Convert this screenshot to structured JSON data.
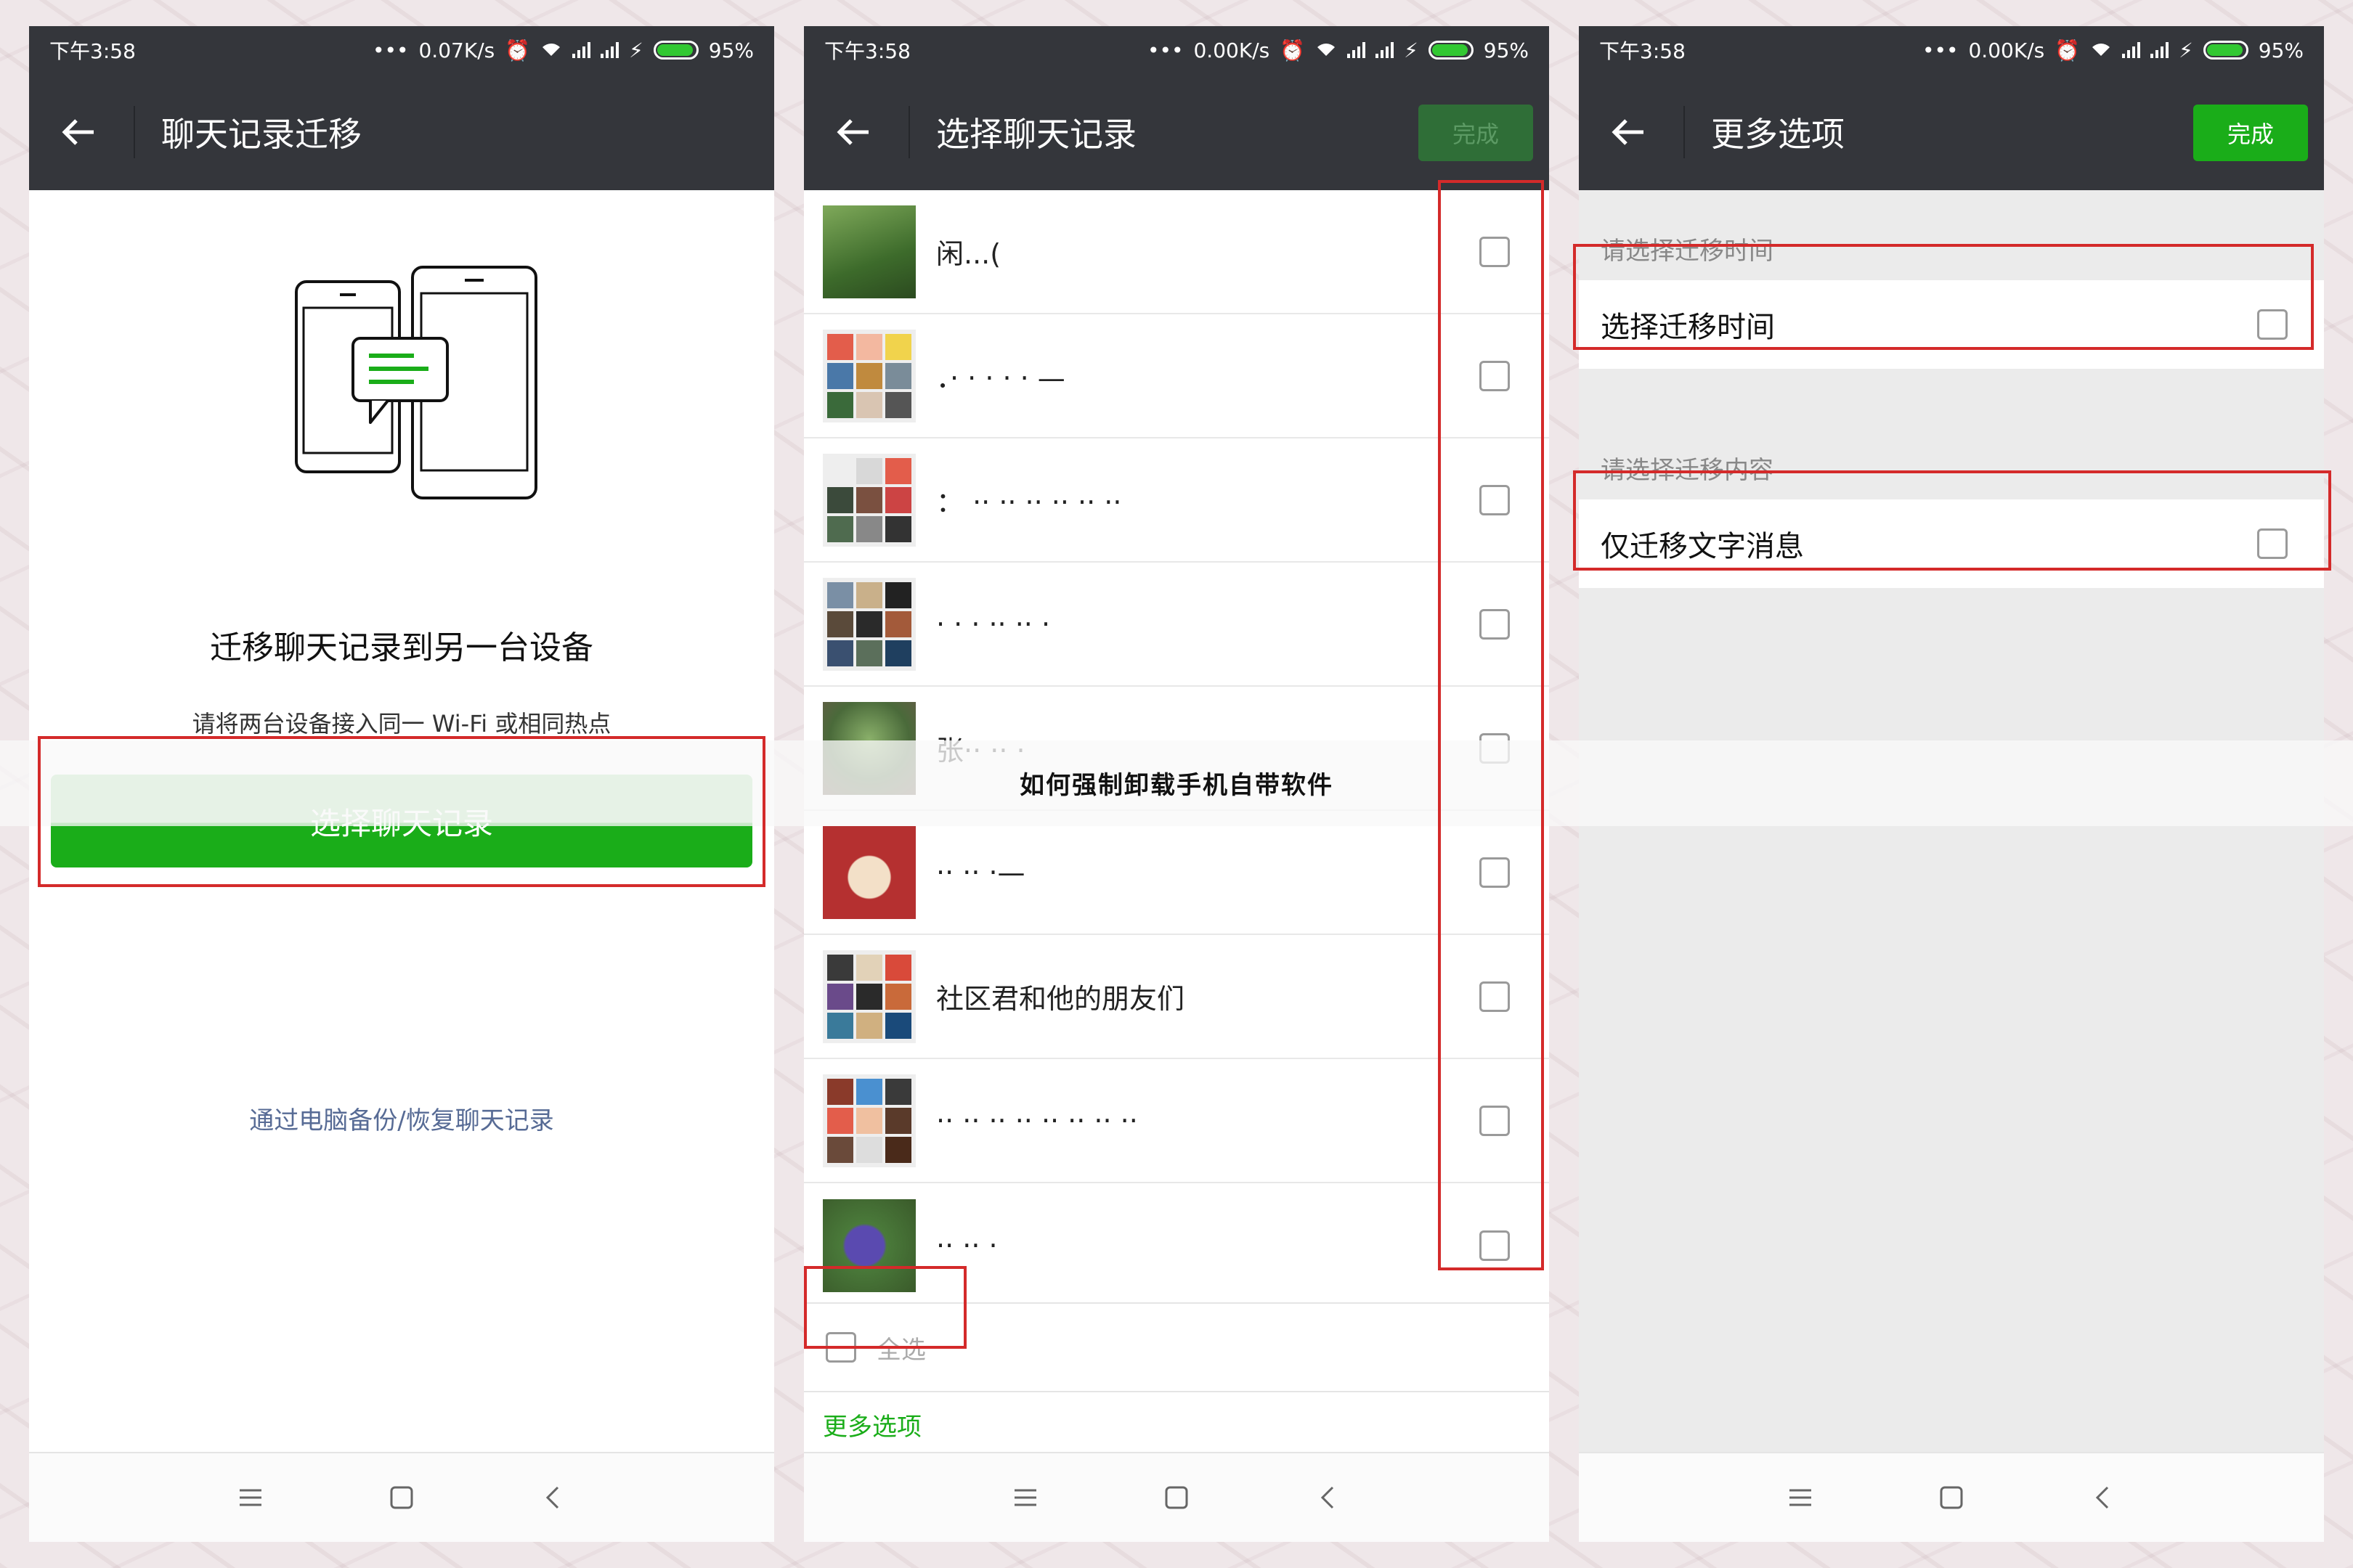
{
  "caption": "如何强制卸载手机自带软件",
  "phones": [
    {
      "status": {
        "time": "下午3:58",
        "speed": "0.07K/s",
        "battery": "95%"
      },
      "title": "聊天记录迁移",
      "heading": "迁移聊天记录到另一台设备",
      "subtext": "请将两台设备接入同一 Wi-Fi 或相同热点",
      "primary_button": "选择聊天记录",
      "link": "通过电脑备份/恢复聊天记录"
    },
    {
      "status": {
        "time": "下午3:58",
        "speed": "0.00K/s",
        "battery": "95%"
      },
      "title": "选择聊天记录",
      "done": "完成",
      "chats": [
        {
          "name": "闲...(",
          "avatar": "single"
        },
        {
          "name": "．· ·  · · · —",
          "avatar": "grid"
        },
        {
          "name": "：  ·· ·· ·· ·· ·· ··",
          "avatar": "grid"
        },
        {
          "name": "· · ·  ·· ·· ·",
          "avatar": "grid"
        },
        {
          "name": "张·· ·· ·",
          "avatar": "single"
        },
        {
          "name": "·· ·· ·—",
          "avatar": "single"
        },
        {
          "name": "社区君和他的朋友们",
          "avatar": "grid"
        },
        {
          "name": "·· ·· ·· ·· ·· ·· ·· ··",
          "avatar": "grid"
        },
        {
          "name": "·· ·· ·",
          "avatar": "single"
        }
      ],
      "select_all": "全选",
      "more_options": "更多选项"
    },
    {
      "status": {
        "time": "下午3:58",
        "speed": "0.00K/s",
        "battery": "95%"
      },
      "title": "更多选项",
      "done": "完成",
      "section1_label": "请选择迁移时间",
      "option1": "选择迁移时间",
      "section2_label": "请选择迁移内容",
      "option2": "仅迁移文字消息"
    }
  ],
  "colors": {
    "accent": "#1aad19",
    "header": "#34363b",
    "highlight_box": "#d42a2a",
    "link": "#576b95"
  }
}
